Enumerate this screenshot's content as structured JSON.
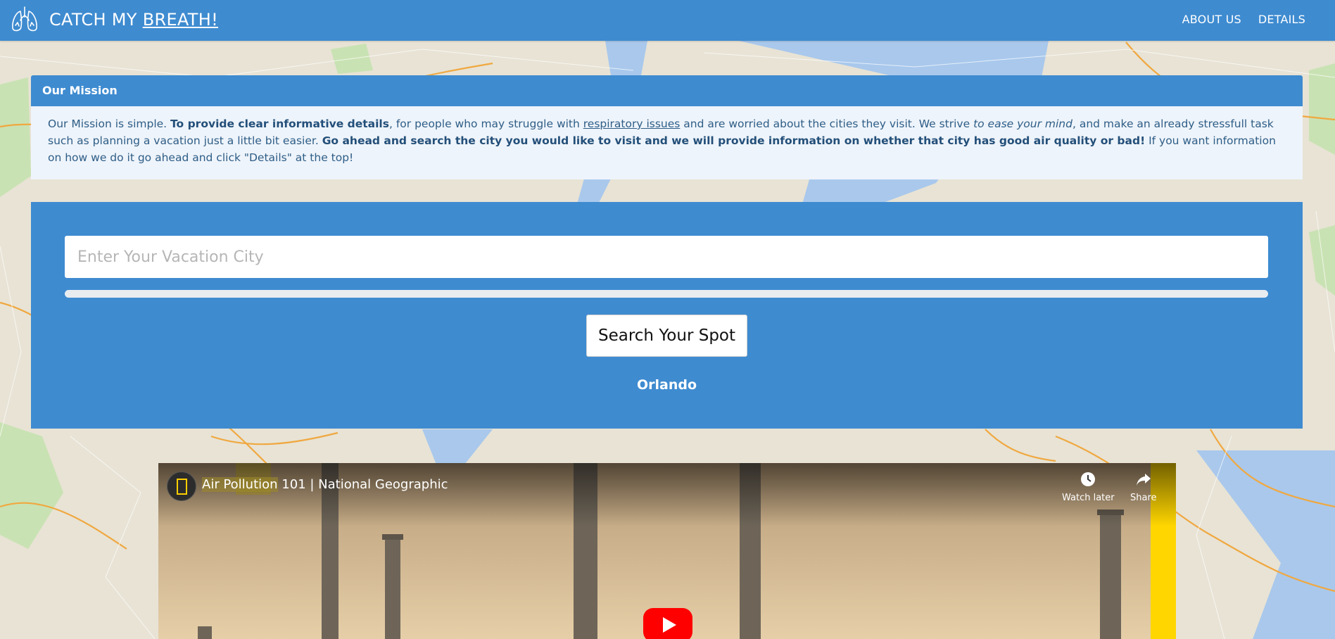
{
  "nav": {
    "brand_prefix": "CATCH MY ",
    "brand_emphasis": "BREATH!",
    "links": [
      "ABOUT US",
      "DETAILS"
    ]
  },
  "mission": {
    "heading": "Our Mission",
    "p1": "Our Mission is simple. ",
    "b1": "To provide clear informative details",
    "p2": ", for people who may struggle with ",
    "link": "respiratory issues",
    "p3": " and are worried about the cities they visit. We strive ",
    "em": "to ease your mind",
    "p4": ", and make an already stressfull task such as planning a vacation just a little bit easier. ",
    "b2": "Go ahead and search the city you would like to visit and we will provide information on whether that city has good air quality or bad!",
    "p5": " If you want information on how we do it go ahead and click \"Details\" at the top!"
  },
  "search": {
    "placeholder": "Enter Your Vacation City",
    "value": "",
    "progress_fraction": 0,
    "button_label": "Search Your Spot",
    "result_city": "Orlando"
  },
  "video": {
    "title_highlight": "Air Pollution",
    "title_rest": " 101 | National Geographic",
    "watch_later": "Watch later",
    "share": "Share"
  },
  "colors": {
    "primary": "#3e8bd0",
    "mission_bg": "#eef4fb",
    "play_red": "#ff0000",
    "natgeo_yellow": "#ffce00"
  },
  "icons": [
    "lungs-icon",
    "clock-icon",
    "share-icon",
    "natgeo-logo-icon",
    "play-icon"
  ]
}
